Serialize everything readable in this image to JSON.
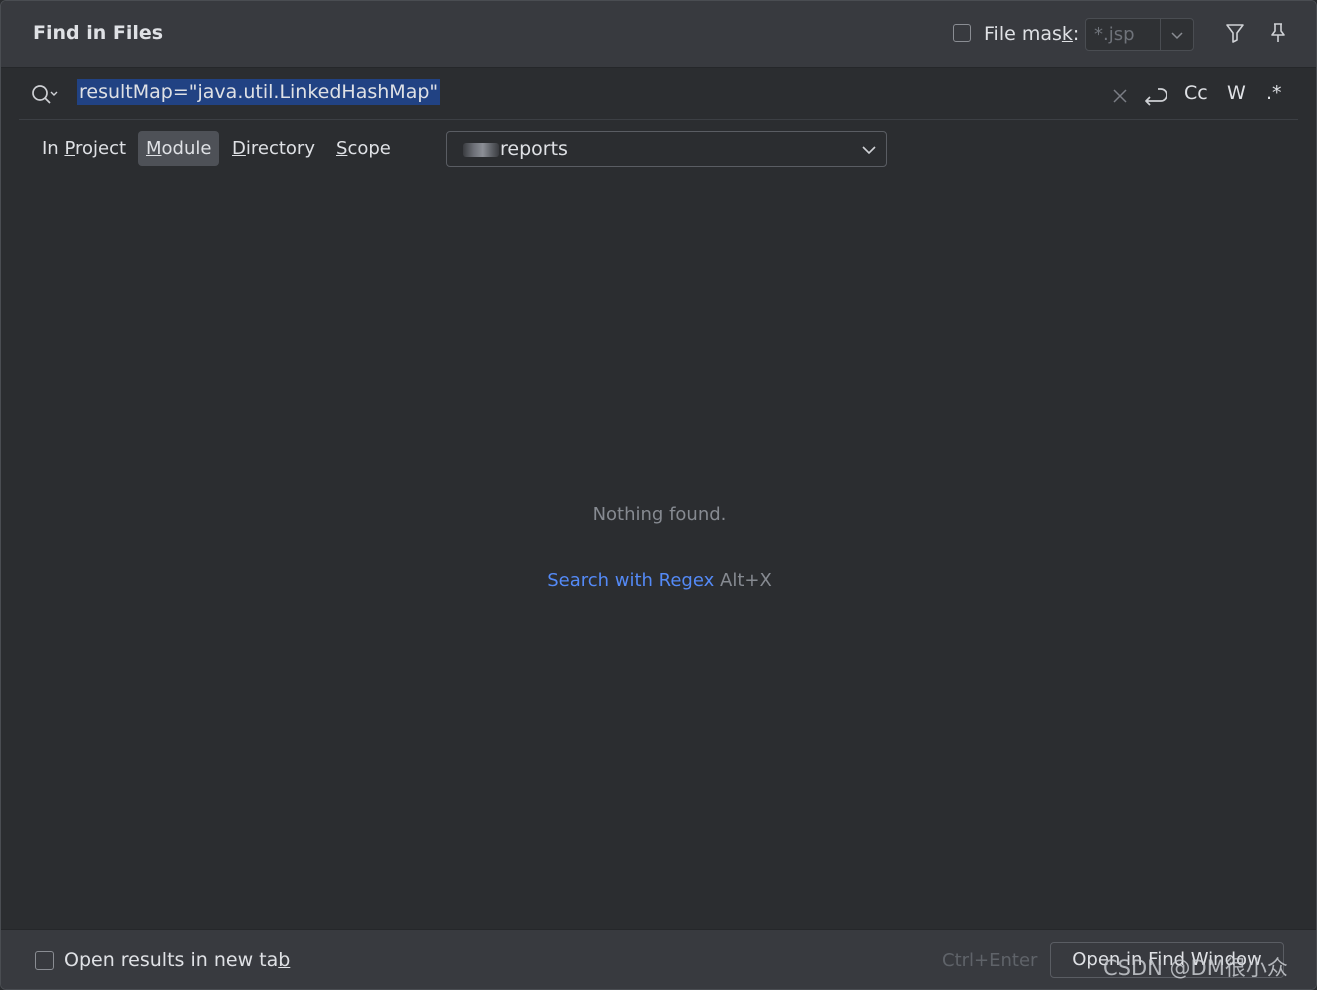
{
  "header": {
    "title": "Find in Files",
    "file_mask_label_pre": "File mas",
    "file_mask_label_u": "k",
    "file_mask_label_post": ":",
    "file_mask_value": "*.jsp",
    "file_mask_checked": false
  },
  "search": {
    "query": "resultMap=\"java.util.LinkedHashMap\"",
    "options": {
      "match_case": "Cc",
      "words": "W",
      "regex": ".*"
    }
  },
  "scope_tabs": [
    {
      "pre": "In ",
      "u": "P",
      "post": "roject",
      "active": false
    },
    {
      "pre": "",
      "u": "M",
      "post": "odule",
      "active": true
    },
    {
      "pre": "",
      "u": "D",
      "post": "irectory",
      "active": false
    },
    {
      "pre": "",
      "u": "S",
      "post": "cope",
      "active": false
    }
  ],
  "module_select": {
    "value": "reports"
  },
  "results": {
    "empty_message": "Nothing found.",
    "regex_link": "Search with Regex",
    "regex_shortcut": "Alt+X"
  },
  "footer": {
    "new_tab_label_pre": "Open results in new ta",
    "new_tab_label_u": "b",
    "new_tab_checked": false,
    "shortcut": "Ctrl+Enter",
    "open_button": "Open in Find Window"
  },
  "watermark": "CSDN @DM很小众",
  "colors": {
    "background": "#2b2d30",
    "header": "#383a3f",
    "selection": "#214283",
    "link": "#548af7",
    "active_tab": "#4e5157"
  },
  "icons": [
    "search-icon",
    "filter-icon",
    "pin-icon",
    "clear-icon",
    "newline-icon",
    "chevron-down-icon"
  ]
}
